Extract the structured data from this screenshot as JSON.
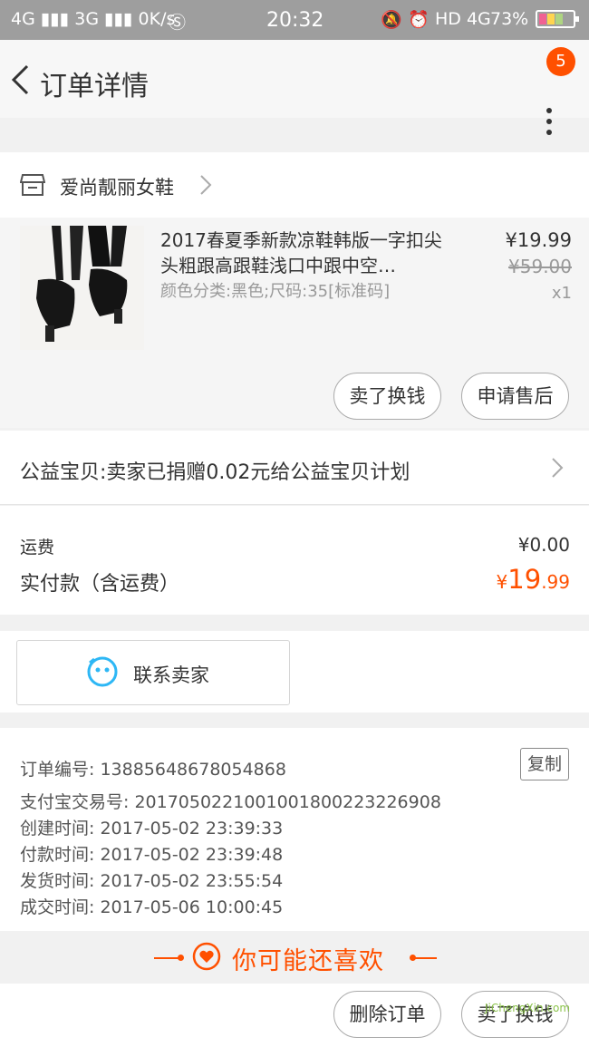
{
  "status_bar": {
    "left": "4G ▮▮▮  3G ▮▮▮  0K/s",
    "time": "20:32",
    "network": "HD 4G",
    "battery": "73%",
    "colors": {
      "bar_bg": "#9e9e9e"
    }
  },
  "header": {
    "title": "订单详情",
    "badge_count": "5"
  },
  "shop": {
    "name": "爱尚靓丽女鞋"
  },
  "product": {
    "title": "2017春夏季新款凉鞋韩版一字扣尖头粗跟高跟鞋浅口中跟中空…",
    "sku": "颜色分类:黑色;尺码:35[标准码]",
    "price": "¥19.99",
    "original_price": "¥59.00",
    "quantity": "x1"
  },
  "actions": {
    "sell_exchange": "卖了换钱",
    "after_sales": "申请售后",
    "delete_order": "删除订单"
  },
  "charity": {
    "text": "公益宝贝:卖家已捐赠0.02元给公益宝贝计划"
  },
  "cost": {
    "shipping_label": "运费",
    "shipping_value": "¥0.00",
    "total_label": "实付款（含运费）",
    "total_currency": "¥",
    "total_int": "19",
    "total_dec": ".99"
  },
  "contact": {
    "label": "联系卖家"
  },
  "order_info": {
    "order_no": "订单编号: 13885648678054868",
    "alipay_no": "支付宝交易号: 2017050221001001800223226908",
    "created": "创建时间: 2017-05-02 23:39:33",
    "paid": "付款时间: 2017-05-02 23:39:48",
    "shipped": "发货时间: 2017-05-02 23:55:54",
    "completed": "成交时间: 2017-05-06 10:00:45",
    "copy_label": "复制"
  },
  "recommend": {
    "label": "你可能还喜欢"
  },
  "watermark": "JiChengXin.com",
  "colors": {
    "accent": "#ff5000",
    "contact_icon": "#2db7f5"
  }
}
